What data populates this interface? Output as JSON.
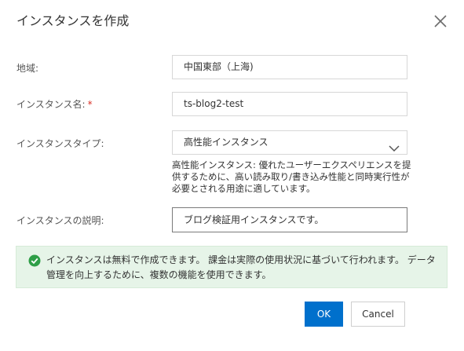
{
  "dialog": {
    "title": "インスタンスを作成",
    "close_icon": "close-icon"
  },
  "form": {
    "region": {
      "label": "地域:",
      "value": "中国東部（上海)"
    },
    "instance_name": {
      "label": "インスタンス名:",
      "required_mark": "*",
      "value": "ts-blog2-test"
    },
    "instance_type": {
      "label": "インスタンスタイプ:",
      "selected": "高性能インスタンス",
      "chevron_icon": "chevron-down-icon",
      "help_text": "高性能インスタンス: 優れたユーザーエクスペリエンスを提供するために、高い読み取り/書き込み性能と同時実行性が必要とされる用途に適しています。"
    },
    "description": {
      "label": "インスタンスの説明:",
      "value": "ブログ検証用インスタンスです。"
    }
  },
  "notice": {
    "icon": "check-circle-icon",
    "text": "インスタンスは無料で作成できます。 課金は実際の使用状況に基づいて行われます。 データ管理を向上するために、複数の機能を使用できます。"
  },
  "footer": {
    "ok_label": "OK",
    "cancel_label": "Cancel"
  },
  "colors": {
    "primary": "#0070cc",
    "success": "#2e9e47",
    "notice_bg": "#e6f4e8",
    "required": "#d93026"
  }
}
